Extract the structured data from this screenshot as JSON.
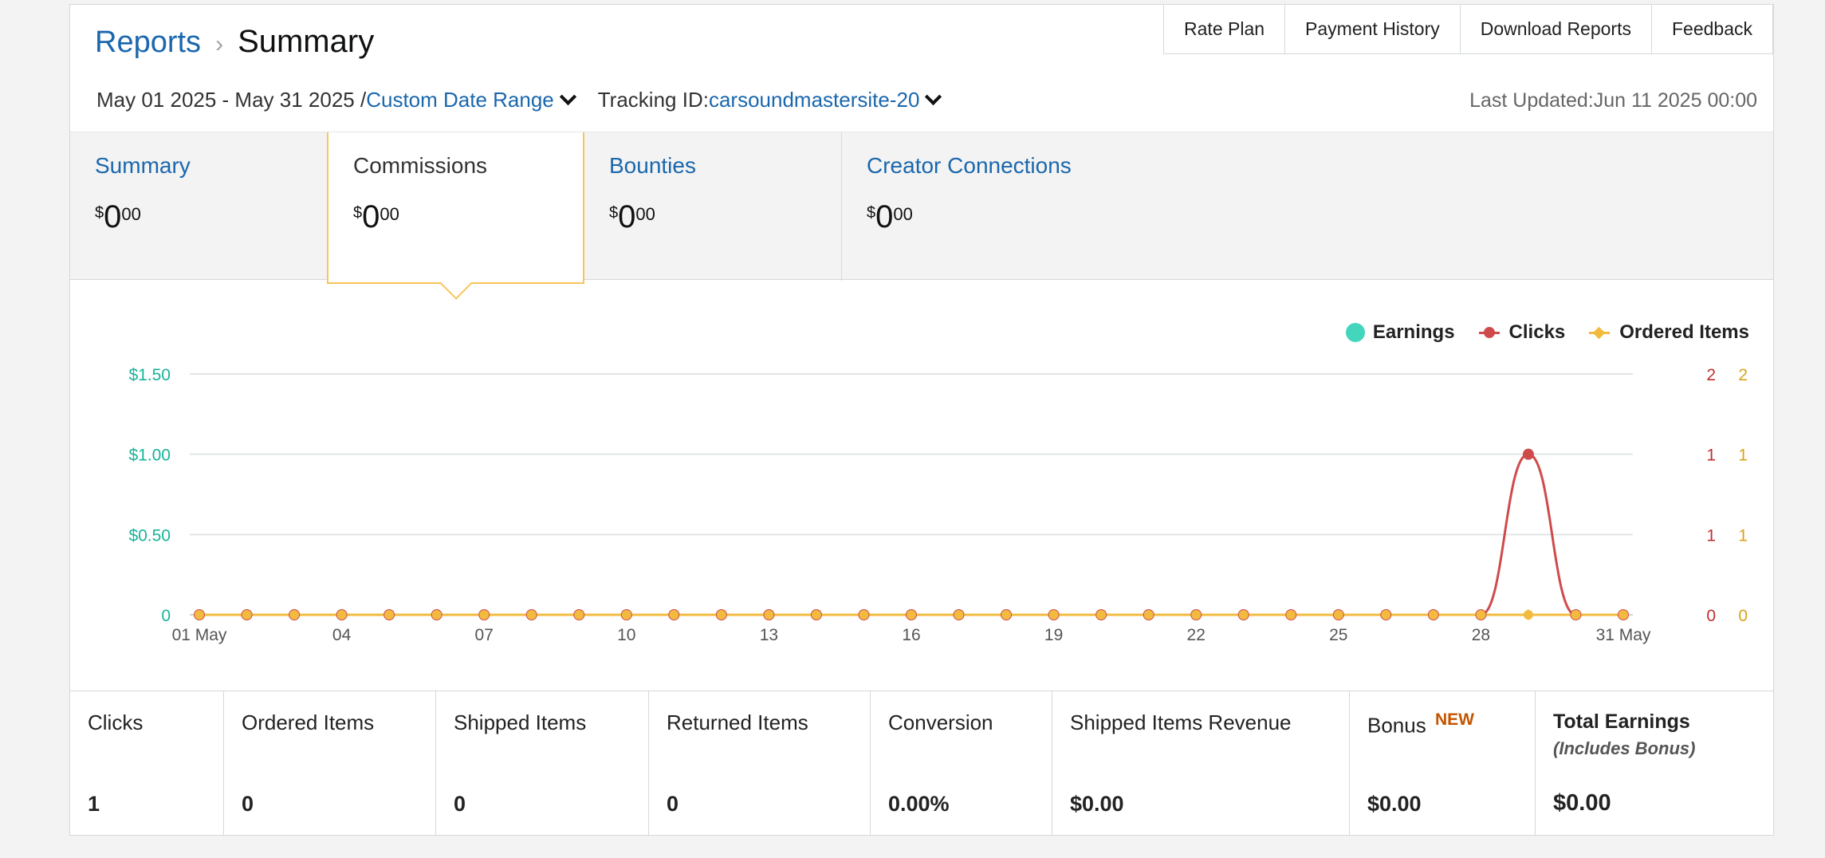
{
  "breadcrumb": {
    "parent": "Reports",
    "separator": "›",
    "current": "Summary"
  },
  "top_links": [
    "Rate Plan",
    "Payment History",
    "Download Reports",
    "Feedback"
  ],
  "filters": {
    "date_range": "May 01 2025 - May 31 2025 /",
    "date_range_link": "Custom Date Range",
    "tracking_label": "Tracking ID:",
    "tracking_id": "carsoundmastersite-20",
    "last_updated": "Last Updated:Jun 11 2025 00:00"
  },
  "tabs": [
    {
      "label": "Summary",
      "currency": "$",
      "integer": "0",
      "decimal": "00",
      "active": false
    },
    {
      "label": "Commissions",
      "currency": "$",
      "integer": "0",
      "decimal": "00",
      "active": true
    },
    {
      "label": "Bounties",
      "currency": "$",
      "integer": "0",
      "decimal": "00",
      "active": false
    },
    {
      "label": "Creator Connections",
      "currency": "$",
      "integer": "0",
      "decimal": "00",
      "active": false
    }
  ],
  "legend": {
    "earnings": "Earnings",
    "clicks": "Clicks",
    "items": "Ordered Items"
  },
  "colors": {
    "earnings": "#19b39b",
    "clicks": "#cf4b4b",
    "items": "#f2bb3f",
    "link": "#1a67ad",
    "active_tab_border": "#f8c55a",
    "new_badge": "#c45500"
  },
  "chart_data": {
    "type": "line",
    "x": [
      "01 May",
      "02 May",
      "03 May",
      "04 May",
      "05 May",
      "06 May",
      "07 May",
      "08 May",
      "09 May",
      "10 May",
      "11 May",
      "12 May",
      "13 May",
      "14 May",
      "15 May",
      "16 May",
      "17 May",
      "18 May",
      "19 May",
      "20 May",
      "21 May",
      "22 May",
      "23 May",
      "24 May",
      "25 May",
      "26 May",
      "27 May",
      "28 May",
      "29 May",
      "30 May",
      "31 May"
    ],
    "xtick_labels": [
      "01 May",
      "04",
      "07",
      "10",
      "13",
      "16",
      "19",
      "22",
      "25",
      "28",
      "31 May"
    ],
    "xtick_indices": [
      0,
      3,
      6,
      9,
      12,
      15,
      18,
      21,
      24,
      27,
      30
    ],
    "series": [
      {
        "name": "Earnings",
        "axis": "left",
        "values": [
          0,
          0,
          0,
          0,
          0,
          0,
          0,
          0,
          0,
          0,
          0,
          0,
          0,
          0,
          0,
          0,
          0,
          0,
          0,
          0,
          0,
          0,
          0,
          0,
          0,
          0,
          0,
          0,
          0,
          0,
          0
        ]
      },
      {
        "name": "Clicks",
        "axis": "right1",
        "values": [
          0,
          0,
          0,
          0,
          0,
          0,
          0,
          0,
          0,
          0,
          0,
          0,
          0,
          0,
          0,
          0,
          0,
          0,
          0,
          0,
          0,
          0,
          0,
          0,
          0,
          0,
          0,
          0,
          1,
          0,
          0
        ]
      },
      {
        "name": "Ordered Items",
        "axis": "right2",
        "values": [
          0,
          0,
          0,
          0,
          0,
          0,
          0,
          0,
          0,
          0,
          0,
          0,
          0,
          0,
          0,
          0,
          0,
          0,
          0,
          0,
          0,
          0,
          0,
          0,
          0,
          0,
          0,
          0,
          0,
          0,
          0
        ]
      }
    ],
    "y_left": {
      "ticks": [
        "0",
        "$0.50",
        "$1.00",
        "$1.50"
      ],
      "range": [
        0,
        1.5
      ]
    },
    "y_right1": {
      "ticks": [
        "0",
        "1",
        "1",
        "2"
      ]
    },
    "y_right2": {
      "ticks": [
        "0",
        "1",
        "1",
        "2"
      ]
    },
    "y_right_range": [
      0,
      1.5
    ],
    "grid": true,
    "legend_position": "top-right"
  },
  "stats": [
    {
      "label": "Clicks",
      "value": "1"
    },
    {
      "label": "Ordered Items",
      "value": "0"
    },
    {
      "label": "Shipped Items",
      "value": "0"
    },
    {
      "label": "Returned Items",
      "value": "0"
    },
    {
      "label": "Conversion",
      "value": "0.00%"
    },
    {
      "label": "Shipped Items Revenue",
      "value": "$0.00"
    },
    {
      "label": "Bonus",
      "badge": "NEW",
      "value": "$0.00"
    },
    {
      "label": "Total Earnings",
      "sublabel": "(Includes Bonus)",
      "value": "$0.00"
    }
  ]
}
